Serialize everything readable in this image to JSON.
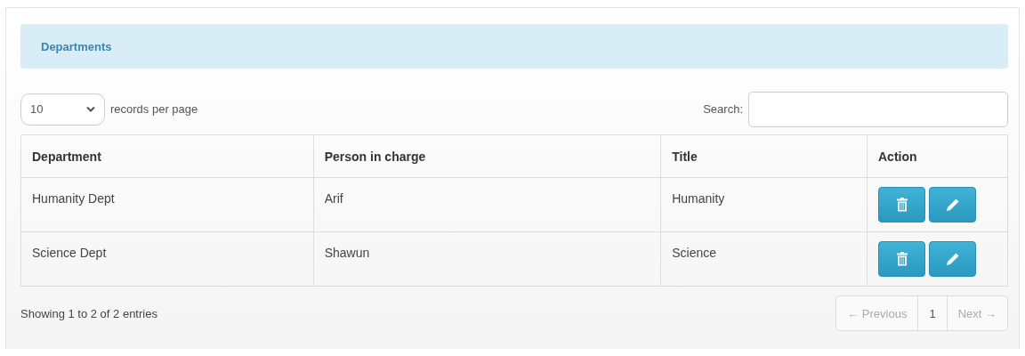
{
  "panel": {
    "title": "Departments"
  },
  "length_menu": {
    "value": "10",
    "label": "records per page"
  },
  "search": {
    "label": "Search:"
  },
  "table": {
    "columns": [
      "Department",
      "Person in charge",
      "Title",
      "Action"
    ],
    "rows": [
      {
        "department": "Humanity Dept",
        "person": "Arif",
        "title": "Humanity"
      },
      {
        "department": "Science Dept",
        "person": "Shawun",
        "title": "Science"
      }
    ]
  },
  "info": "Showing 1 to 2 of 2 entries",
  "pagination": [
    {
      "label": "← Previous",
      "disabled": true
    },
    {
      "label": "1",
      "disabled": false
    },
    {
      "label": "Next →",
      "disabled": true
    }
  ]
}
